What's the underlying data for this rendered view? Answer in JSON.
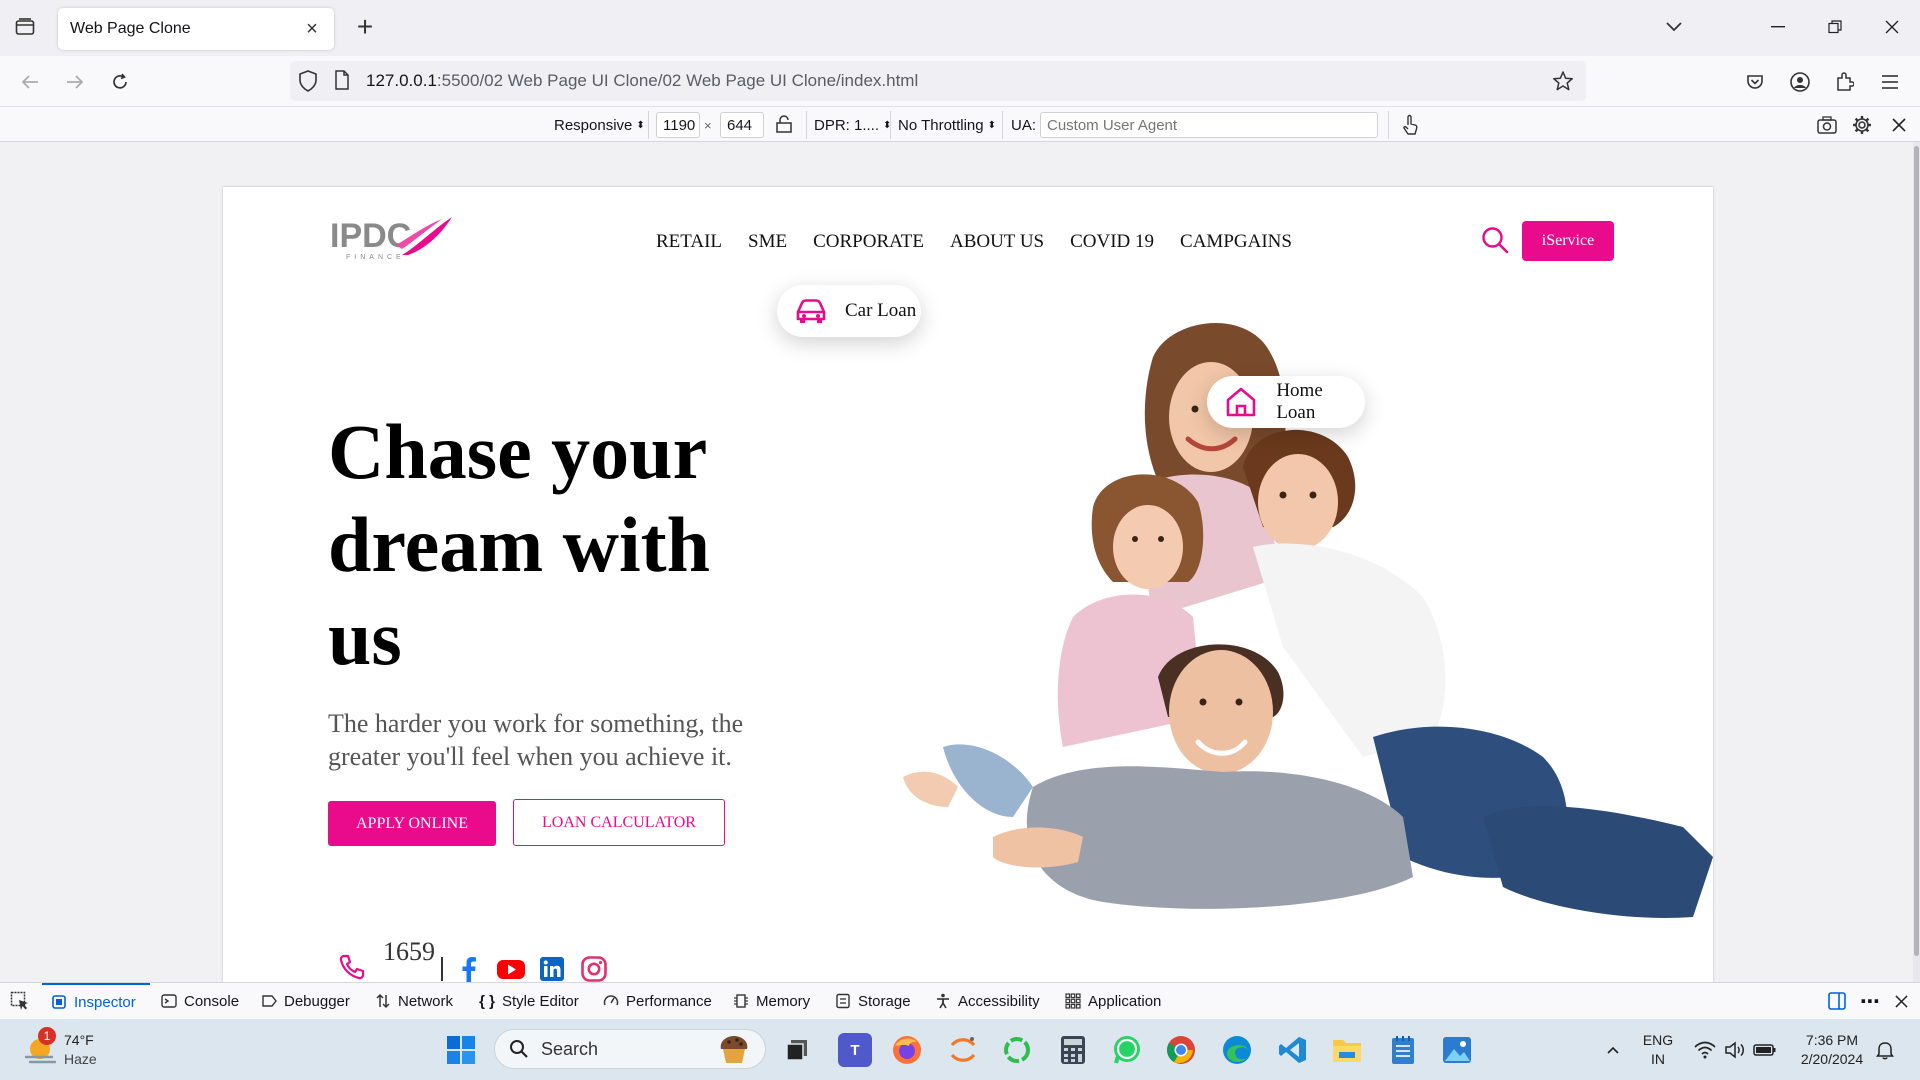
{
  "browser": {
    "tab_title": "Web Page Clone",
    "url_host": "127.0.0.1",
    "url_rest": ":5500/02 Web Page UI Clone/02 Web Page UI Clone/index.html"
  },
  "rdm": {
    "device": "Responsive",
    "width": "1190",
    "times": "×",
    "height": "644",
    "dpr": "DPR: 1....",
    "throttling": "No Throttling",
    "ua_label": "UA:",
    "ua_placeholder": "Custom User Agent"
  },
  "site": {
    "logo_text": "IPDC",
    "logo_sub": "FINANCE",
    "menu": [
      "RETAIL",
      "SME",
      "CORPORATE",
      "ABOUT US",
      "COVID 19",
      "CAMPGAINS"
    ],
    "iservice": "iService",
    "hero_title": "Chase your dream with us",
    "hero_sub": "The harder you work for something, the greater you'll feel when you achieve it.",
    "apply": "APPLY ONLINE",
    "calculator": "LOAN CALCULATOR",
    "hotline": "1659",
    "car_loan": "Car Loan",
    "home_loan": "Home Loan"
  },
  "devtools": {
    "tabs": [
      "Inspector",
      "Console",
      "Debugger",
      "Network",
      "Style Editor",
      "Performance",
      "Memory",
      "Storage",
      "Accessibility",
      "Application"
    ]
  },
  "taskbar": {
    "weather_badge": "1",
    "temp": "74°F",
    "condition": "Haze",
    "search": "Search",
    "lang_top": "ENG",
    "lang_bottom": "IN",
    "time": "7:36 PM",
    "date": "2/20/2024"
  },
  "colors": {
    "brand_pink": "#ea0a8c",
    "devtools_active": "#0061e0"
  }
}
